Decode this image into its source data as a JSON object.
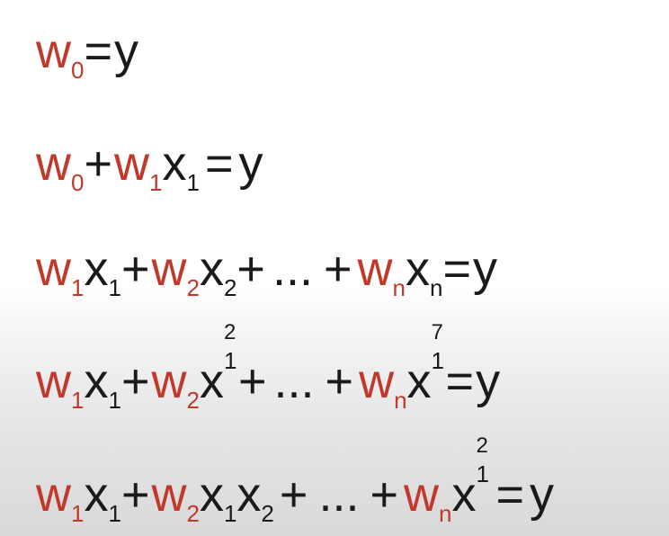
{
  "equations": [
    {
      "id": "eq1",
      "tokens": [
        {
          "t": "w",
          "s": "w",
          "sub": "0"
        },
        {
          "t": "op",
          "s": "= ",
          "tight": true
        },
        {
          "t": "y",
          "s": "y"
        }
      ]
    },
    {
      "id": "eq2",
      "tokens": [
        {
          "t": "w",
          "s": "w",
          "sub": "0"
        },
        {
          "t": "op",
          "s": "+ ",
          "tight": true
        },
        {
          "t": "w",
          "s": "w",
          "sub": "1"
        },
        {
          "t": "x",
          "s": "x",
          "sub": "1"
        },
        {
          "t": "op",
          "s": "="
        },
        {
          "t": "y",
          "s": "y"
        }
      ]
    },
    {
      "id": "eq3",
      "tokens": [
        {
          "t": "w",
          "s": "w",
          "sub": "1"
        },
        {
          "t": "x",
          "s": "x",
          "sub": "1"
        },
        {
          "t": "op",
          "s": "+",
          "tight": true
        },
        {
          "t": "w",
          "s": "w",
          "sub": "2"
        },
        {
          "t": "x",
          "s": "x",
          "sub": "2"
        },
        {
          "t": "op",
          "s": "+",
          "tight": true
        },
        {
          "t": "dots",
          "s": "..."
        },
        {
          "t": "op",
          "s": "+"
        },
        {
          "t": "w",
          "s": "w",
          "sub": "n"
        },
        {
          "t": "x",
          "s": "x",
          "sub": "n"
        },
        {
          "t": "op",
          "s": "= ",
          "tight": true
        },
        {
          "t": "y",
          "s": "y"
        }
      ]
    },
    {
      "id": "eq4",
      "tokens": [
        {
          "t": "w",
          "s": "w",
          "sub": "1"
        },
        {
          "t": "x",
          "s": "x",
          "sub": "1"
        },
        {
          "t": "op",
          "s": "+",
          "tight": true
        },
        {
          "t": "w",
          "s": "w",
          "sub": "2"
        },
        {
          "t": "x",
          "s": "x",
          "sub": "1",
          "sup": "2"
        },
        {
          "t": "op",
          "s": "+",
          "tight": true
        },
        {
          "t": "dots",
          "s": "..."
        },
        {
          "t": "op",
          "s": "+"
        },
        {
          "t": "w",
          "s": "w",
          "sub": "n"
        },
        {
          "t": "x",
          "s": "x",
          "sub": "1",
          "sup": "7"
        },
        {
          "t": "op",
          "s": "= ",
          "tight": true
        },
        {
          "t": "y",
          "s": "y"
        }
      ]
    },
    {
      "id": "eq5",
      "tokens": [
        {
          "t": "w",
          "s": "w",
          "sub": "1"
        },
        {
          "t": "x",
          "s": "x",
          "sub": "1"
        },
        {
          "t": "op",
          "s": "+",
          "tight": true
        },
        {
          "t": "w",
          "s": "w",
          "sub": "2"
        },
        {
          "t": "x",
          "s": "x",
          "sub": "1"
        },
        {
          "t": "x",
          "s": "x",
          "sub": "2"
        },
        {
          "t": "op",
          "s": "+"
        },
        {
          "t": "dots",
          "s": "..."
        },
        {
          "t": "op",
          "s": "+"
        },
        {
          "t": "w",
          "s": "w",
          "sub": "n"
        },
        {
          "t": "x",
          "s": "x",
          "sub": "1",
          "sup": "2"
        },
        {
          "t": "op",
          "s": "="
        },
        {
          "t": "y",
          "s": "y"
        }
      ]
    }
  ],
  "colors": {
    "coefficient": "#c0392b",
    "text": "#1a1a1a"
  }
}
